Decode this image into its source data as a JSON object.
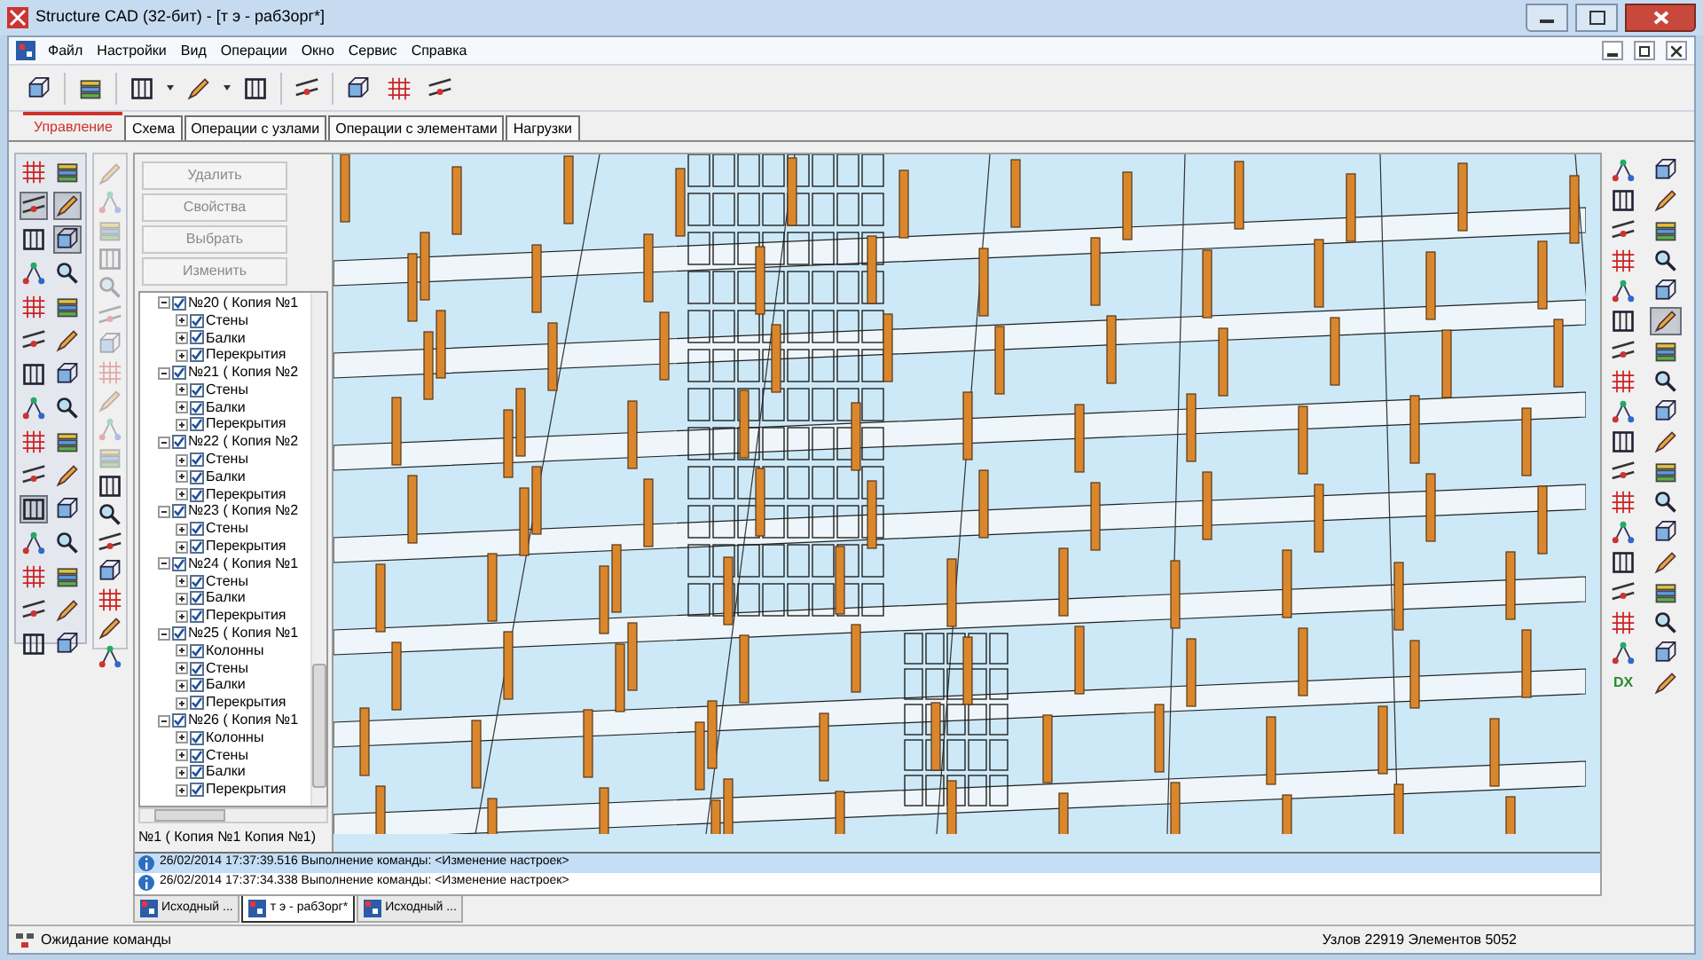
{
  "window": {
    "title": "Structure CAD (32-бит) - [т э - раб3орг*]"
  },
  "menu": [
    "Файл",
    "Настройки",
    "Вид",
    "Операции",
    "Окно",
    "Сервис",
    "Справка"
  ],
  "tabs": [
    {
      "label": "Управление",
      "selected": true
    },
    {
      "label": "Схема",
      "selected": false
    },
    {
      "label": "Операции с узлами",
      "selected": false
    },
    {
      "label": "Операции с элементами",
      "selected": false
    },
    {
      "label": "Нагрузки",
      "selected": false
    }
  ],
  "left_toolbar": [
    {
      "pressed": false
    },
    {
      "pressed": false
    },
    {
      "pressed": true
    },
    {
      "pressed": true
    },
    {
      "pressed": false
    },
    {
      "pressed": true
    },
    {
      "pressed": false
    },
    {
      "pressed": false
    },
    {
      "pressed": false
    },
    {
      "pressed": false
    },
    {
      "pressed": false
    },
    {
      "pressed": false
    },
    {
      "pressed": false
    },
    {
      "pressed": false
    },
    {
      "pressed": false
    },
    {
      "pressed": false
    },
    {
      "pressed": false
    },
    {
      "pressed": false
    },
    {
      "pressed": false
    },
    {
      "pressed": false
    },
    {
      "pressed": true
    },
    {
      "pressed": false
    },
    {
      "pressed": false
    },
    {
      "pressed": false
    },
    {
      "pressed": false
    },
    {
      "pressed": false
    },
    {
      "pressed": false
    },
    {
      "pressed": false
    },
    {
      "pressed": false
    },
    {
      "pressed": false
    }
  ],
  "side_tools": [
    {
      "disabled": true
    },
    {
      "disabled": true
    },
    {
      "disabled": true
    },
    {
      "disabled": true
    },
    {
      "disabled": true
    },
    {
      "disabled": true
    },
    {
      "disabled": true
    },
    {
      "disabled": true
    },
    {
      "disabled": true
    },
    {
      "disabled": true
    },
    {
      "disabled": true
    },
    {
      "disabled": false
    },
    {
      "disabled": false
    },
    {
      "disabled": false
    },
    {
      "disabled": false
    },
    {
      "disabled": false
    },
    {
      "disabled": false
    },
    {
      "disabled": false
    }
  ],
  "tree_panel": {
    "buttons": [
      {
        "label": "Удалить",
        "disabled": true
      },
      {
        "label": "Свойства",
        "disabled": true
      },
      {
        "label": "Выбрать",
        "disabled": true
      },
      {
        "label": "Изменить",
        "disabled": true
      }
    ],
    "nodes": [
      {
        "label": "№20 ( Копия №1",
        "checked": true,
        "expanded": true,
        "children": [
          {
            "label": "Стены",
            "checked": true,
            "expanded": false
          },
          {
            "label": "Балки",
            "checked": true,
            "expanded": false
          },
          {
            "label": "Перекрытия",
            "checked": true,
            "expanded": false
          }
        ]
      },
      {
        "label": "№21 ( Копия №2",
        "checked": true,
        "expanded": true,
        "children": [
          {
            "label": "Стены",
            "checked": true,
            "expanded": false
          },
          {
            "label": "Балки",
            "checked": true,
            "expanded": false
          },
          {
            "label": "Перекрытия",
            "checked": true,
            "expanded": false
          }
        ]
      },
      {
        "label": "№22 ( Копия №2",
        "checked": true,
        "expanded": true,
        "children": [
          {
            "label": "Стены",
            "checked": true,
            "expanded": false
          },
          {
            "label": "Балки",
            "checked": true,
            "expanded": false
          },
          {
            "label": "Перекрытия",
            "checked": true,
            "expanded": false
          }
        ]
      },
      {
        "label": "№23 ( Копия №2",
        "checked": true,
        "expanded": true,
        "children": [
          {
            "label": "Стены",
            "checked": true,
            "expanded": false
          },
          {
            "label": "Перекрытия",
            "checked": true,
            "expanded": false
          }
        ]
      },
      {
        "label": "№24 ( Копия №1",
        "checked": true,
        "expanded": true,
        "children": [
          {
            "label": "Стены",
            "checked": true,
            "expanded": false
          },
          {
            "label": "Балки",
            "checked": true,
            "expanded": false
          },
          {
            "label": "Перекрытия",
            "checked": true,
            "expanded": false
          }
        ]
      },
      {
        "label": "№25 ( Копия №1",
        "checked": true,
        "expanded": true,
        "children": [
          {
            "label": "Колонны",
            "checked": true,
            "expanded": false
          },
          {
            "label": "Стены",
            "checked": true,
            "expanded": false
          },
          {
            "label": "Балки",
            "checked": true,
            "expanded": false
          },
          {
            "label": "Перекрытия",
            "checked": true,
            "expanded": false
          }
        ]
      },
      {
        "label": "№26 ( Копия №1",
        "checked": true,
        "expanded": true,
        "children": [
          {
            "label": "Колонны",
            "checked": true,
            "expanded": false
          },
          {
            "label": "Стены",
            "checked": true,
            "expanded": false
          },
          {
            "label": "Балки",
            "checked": true,
            "expanded": false
          },
          {
            "label": "Перекрытия",
            "checked": true,
            "expanded": false
          }
        ]
      }
    ],
    "footer": "№1 ( Копия №1 Копия №1)"
  },
  "right_toolbar": [
    {
      "kind": "icon",
      "pressed": false
    },
    {
      "kind": "icon",
      "pressed": false
    },
    {
      "kind": "icon",
      "pressed": false
    },
    {
      "kind": "icon",
      "pressed": false
    },
    {
      "kind": "icon",
      "pressed": false
    },
    {
      "kind": "icon",
      "pressed": false
    },
    {
      "kind": "icon",
      "pressed": false
    },
    {
      "kind": "icon",
      "pressed": false
    },
    {
      "kind": "icon",
      "pressed": false
    },
    {
      "kind": "icon",
      "pressed": false
    },
    {
      "kind": "icon",
      "pressed": false
    },
    {
      "kind": "icon",
      "pressed": true
    },
    {
      "kind": "icon",
      "pressed": false
    },
    {
      "kind": "icon",
      "pressed": false
    },
    {
      "kind": "icon",
      "pressed": false
    },
    {
      "kind": "icon",
      "pressed": false
    },
    {
      "kind": "icon",
      "pressed": false
    },
    {
      "kind": "icon",
      "pressed": false
    },
    {
      "kind": "icon",
      "pressed": false
    },
    {
      "kind": "icon",
      "pressed": false
    },
    {
      "kind": "icon",
      "pressed": false
    },
    {
      "kind": "icon",
      "pressed": false
    },
    {
      "kind": "icon",
      "pressed": false
    },
    {
      "kind": "icon",
      "pressed": false
    },
    {
      "kind": "icon",
      "pressed": false
    },
    {
      "kind": "icon",
      "pressed": false
    },
    {
      "kind": "icon",
      "pressed": false
    },
    {
      "kind": "icon",
      "pressed": false
    },
    {
      "kind": "icon",
      "pressed": false
    },
    {
      "kind": "icon",
      "pressed": false
    },
    {
      "kind": "icon",
      "pressed": false
    },
    {
      "kind": "icon",
      "pressed": false
    },
    {
      "kind": "icon",
      "pressed": false
    },
    {
      "kind": "icon",
      "pressed": false
    },
    {
      "kind": "text",
      "label": "DX",
      "pressed": false
    },
    {
      "kind": "icon",
      "pressed": false
    }
  ],
  "log": [
    {
      "text": "26/02/2014 17:37:39.516 Выполнение команды: <Изменение настроек>",
      "selected": true
    },
    {
      "text": "26/02/2014 17:37:34.338 Выполнение команды: <Изменение настроек>",
      "selected": false
    }
  ],
  "documents": [
    {
      "label": "Исходный ...",
      "selected": false
    },
    {
      "label": "т э - раб3орг*",
      "selected": true
    },
    {
      "label": "Исходный ...",
      "selected": false
    }
  ],
  "status_bar": {
    "message": "Ожидание команды",
    "counts": "Узлов 22919 Элементов 5052"
  }
}
